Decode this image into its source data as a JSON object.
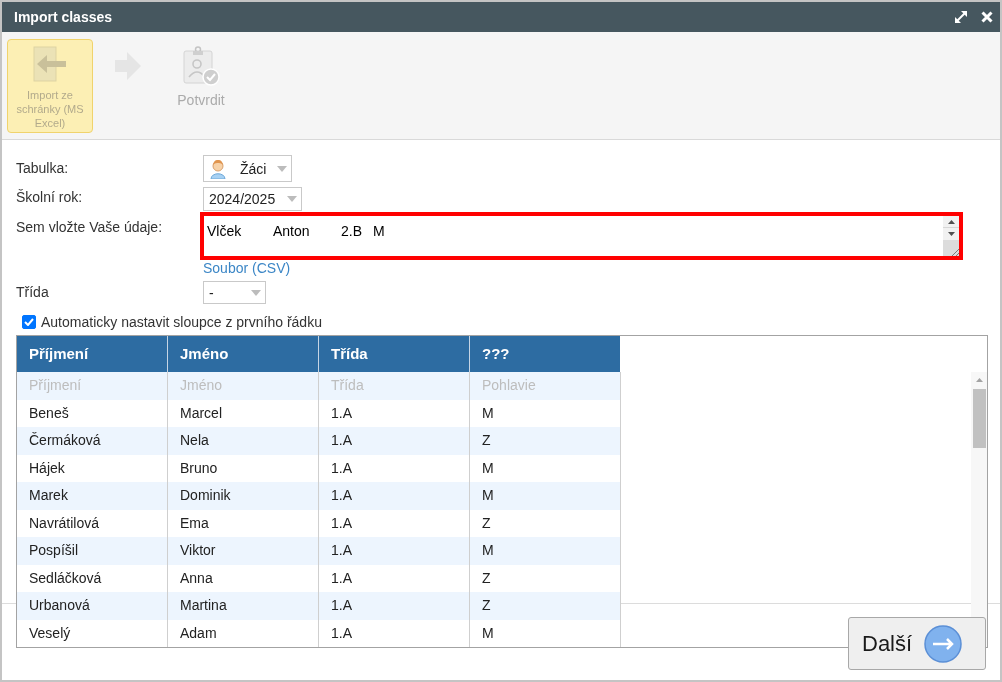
{
  "window": {
    "title": "Import classes"
  },
  "toolbar": {
    "steps": [
      {
        "label": "Import ze schránky (MS Excel)",
        "selected": true
      },
      {
        "label": "Potvrdit",
        "selected": false
      }
    ]
  },
  "form": {
    "table_select": {
      "label": "Tabulka:",
      "value": "Žáci"
    },
    "school_year": {
      "label": "Školní rok:",
      "value": "2024/2025"
    },
    "data_input": {
      "label": "Sem vložte Vaše údaje:",
      "highlighted": true,
      "lines": [
        [
          "Vlček",
          "Anton",
          "2.B",
          "M"
        ]
      ]
    },
    "file_link": "Soubor (CSV)",
    "class_select": {
      "label": "Třída",
      "value": "-"
    },
    "auto_columns": {
      "label": "Automaticky nastavit sloupce z prvního řádku",
      "checked": true
    }
  },
  "table": {
    "columns": [
      "Příjmení",
      "Jméno",
      "Třída",
      "???"
    ],
    "mapping_row": [
      "Příjmení",
      "Jméno",
      "Třída",
      "Pohlavie"
    ],
    "rows": [
      [
        "Beneš",
        "Marcel",
        "1.A",
        "M"
      ],
      [
        "Čermáková",
        "Nela",
        "1.A",
        "Z"
      ],
      [
        "Hájek",
        "Bruno",
        "1.A",
        "M"
      ],
      [
        "Marek",
        "Dominik",
        "1.A",
        "M"
      ],
      [
        "Navrátilová",
        "Ema",
        "1.A",
        "Z"
      ],
      [
        "Pospíšil",
        "Viktor",
        "1.A",
        "M"
      ],
      [
        "Sedláčková",
        "Anna",
        "1.A",
        "Z"
      ],
      [
        "Urbanová",
        "Martina",
        "1.A",
        "Z"
      ],
      [
        "Veselý",
        "Adam",
        "1.A",
        "M"
      ]
    ]
  },
  "footer": {
    "next_button": "Další"
  }
}
